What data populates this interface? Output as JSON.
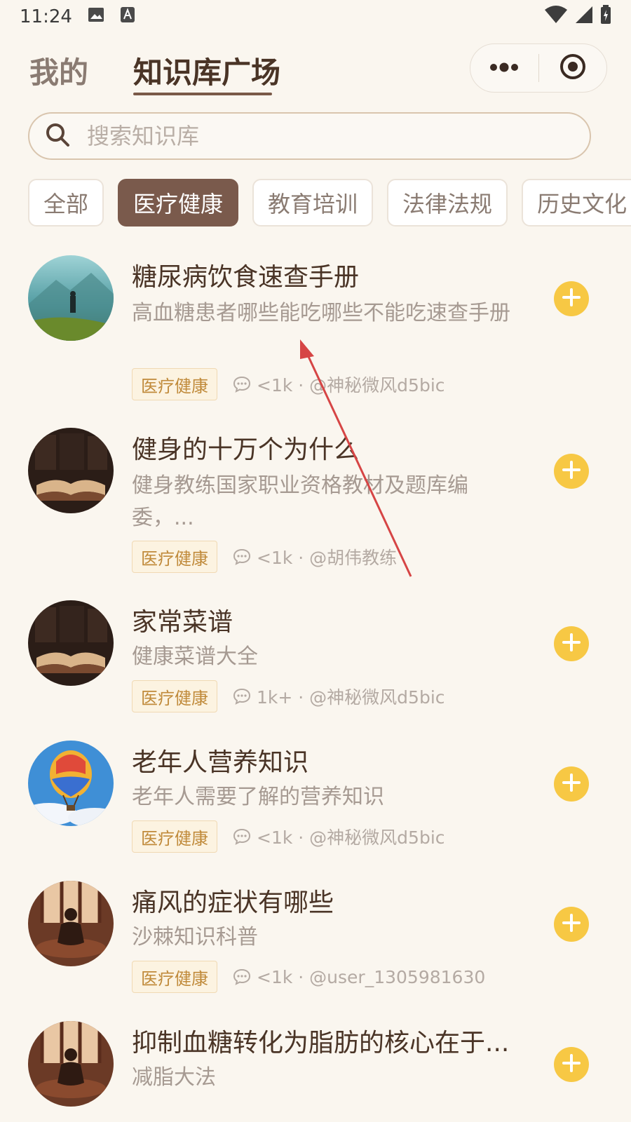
{
  "status_bar": {
    "time": "11:24"
  },
  "header": {
    "tabs": [
      {
        "label": "我的"
      },
      {
        "label": "知识库广场"
      }
    ]
  },
  "search": {
    "placeholder": "搜索知识库"
  },
  "categories": [
    {
      "label": "全部"
    },
    {
      "label": "医疗健康",
      "selected": true
    },
    {
      "label": "教育培训"
    },
    {
      "label": "法律法规"
    },
    {
      "label": "历史文化"
    }
  ],
  "items": [
    {
      "title": "糖尿病饮食速查手册",
      "description": "高血糖患者哪些能吃哪些不能吃速查手册",
      "tag": "医疗健康",
      "meta": "<1k · @神秘微风d5bic",
      "avatar": "mountain-hiker"
    },
    {
      "title": "健身的十万个为什么",
      "description": "健身教练国家职业资格教材及题库编委，...",
      "tag": "医疗健康",
      "meta": "<1k · @胡伟教练",
      "avatar": "open-book"
    },
    {
      "title": "家常菜谱",
      "description": "健康菜谱大全",
      "tag": "医疗健康",
      "meta": "1k+ · @神秘微风d5bic",
      "avatar": "open-book"
    },
    {
      "title": "老年人营养知识",
      "description": "老年人需要了解的营养知识",
      "tag": "医疗健康",
      "meta": "<1k · @神秘微风d5bic",
      "avatar": "hot-air-balloon"
    },
    {
      "title": "痛风的症状有哪些",
      "description": "沙棘知识科普",
      "tag": "医疗健康",
      "meta": "<1k · @user_1305981630",
      "avatar": "meditation"
    },
    {
      "title": "抑制血糖转化为脂肪的核心在于...",
      "description": "减脂大法",
      "avatar": "meditation"
    }
  ],
  "colors": {
    "background": "#faf6ef",
    "accent_brown": "#7a5a4c",
    "add_button": "#f7c844",
    "tag_text": "#c08a3a",
    "annotation_arrow": "#d64545"
  }
}
